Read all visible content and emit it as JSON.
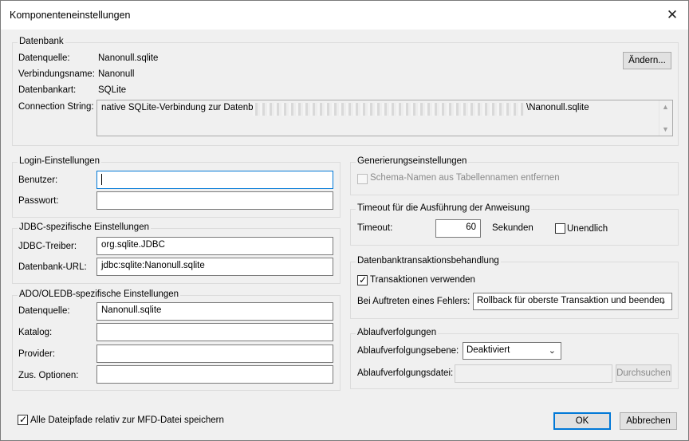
{
  "window": {
    "title": "Komponenteneinstellungen"
  },
  "datenbank": {
    "legend": "Datenbank",
    "datenquelle_label": "Datenquelle:",
    "datenquelle_value": "Nanonull.sqlite",
    "verbindungsname_label": "Verbindungsname:",
    "verbindungsname_value": "Nanonull",
    "datenbankart_label": "Datenbankart:",
    "datenbankart_value": "SQLite",
    "connection_label": "Connection String:",
    "connection_prefix": "native SQLite-Verbindung zur Datenbank",
    "connection_suffix": "\\Nanonull.sqlite",
    "change_button": "Ändern..."
  },
  "login": {
    "legend": "Login-Einstellungen",
    "benutzer_label": "Benutzer:",
    "benutzer_value": "",
    "passwort_label": "Passwort:",
    "passwort_value": ""
  },
  "jdbc": {
    "legend": "JDBC-spezifische Einstellungen",
    "treiber_label": "JDBC-Treiber:",
    "treiber_value": "org.sqlite.JDBC",
    "url_label": "Datenbank-URL:",
    "url_value": "jdbc:sqlite:Nanonull.sqlite"
  },
  "ado": {
    "legend": "ADO/OLEDB-spezifische Einstellungen",
    "datenquelle_label": "Datenquelle:",
    "datenquelle_value": "Nanonull.sqlite",
    "katalog_label": "Katalog:",
    "katalog_value": "",
    "provider_label": "Provider:",
    "provider_value": "",
    "optionen_label": "Zus. Optionen:",
    "optionen_value": ""
  },
  "generierung": {
    "legend": "Generierungseinstellungen",
    "schema_label": "Schema-Namen aus Tabellennamen entfernen",
    "schema_checked": false
  },
  "timeout": {
    "legend": "Timeout für die Ausführung der Anweisung",
    "timeout_label": "Timeout:",
    "timeout_value": "60",
    "unit": "Sekunden",
    "unendlich_label": "Unendlich",
    "unendlich_checked": false
  },
  "transaktion": {
    "legend": "Datenbanktransaktionsbehandlung",
    "use_label": "Transaktionen verwenden",
    "use_checked": true,
    "error_label": "Bei Auftreten eines Fehlers:",
    "error_value": "Rollback für oberste Transaktion und beenden"
  },
  "ablauf": {
    "legend": "Ablaufverfolgungen",
    "ebene_label": "Ablaufverfolgungsebene:",
    "ebene_value": "Deaktiviert",
    "datei_label": "Ablaufverfolgungsdatei:",
    "datei_value": "",
    "browse_button": "Durchsuchen"
  },
  "footer": {
    "relative_label": "Alle Dateipfade relativ zur MFD-Datei speichern",
    "relative_checked": true,
    "ok_button": "OK",
    "cancel_button": "Abbrechen"
  },
  "icons": {
    "close": "close-icon",
    "check": "checkmark-icon",
    "dropdown": "chevron-down-icon"
  }
}
